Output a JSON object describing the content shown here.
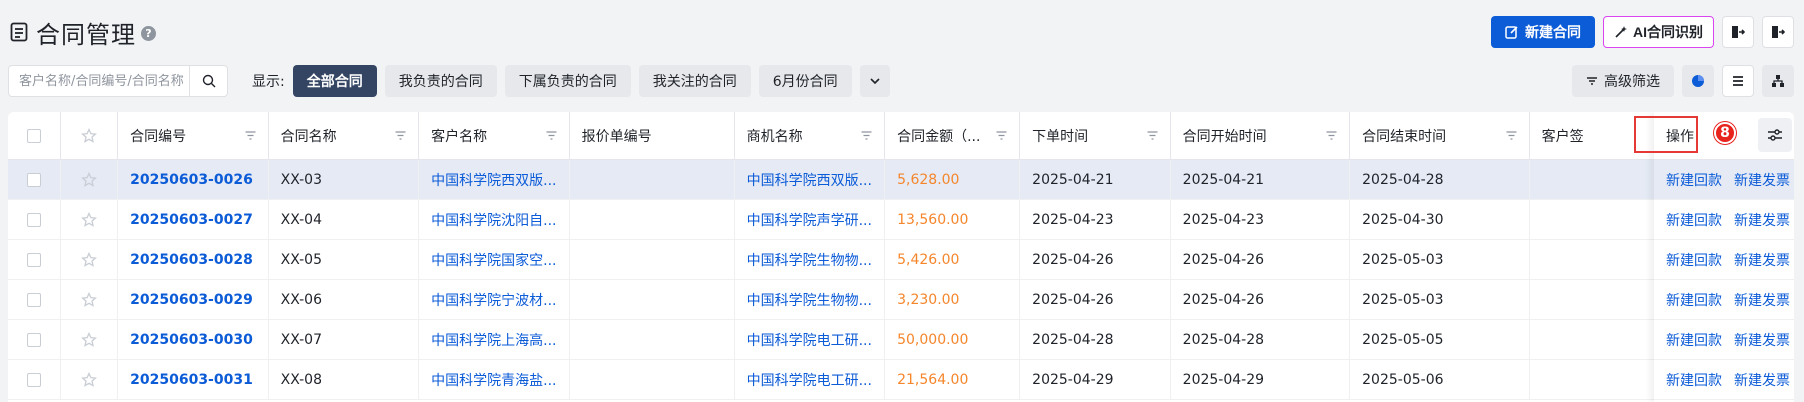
{
  "header": {
    "title": "合同管理",
    "help": "?",
    "new_contract": "新建合同",
    "ai_recognize": "AI合同识别"
  },
  "filters": {
    "search_placeholder": "客户名称/合同编号/合同名称",
    "show_label": "显示:",
    "chips": [
      "全部合同",
      "我负责的合同",
      "下属负责的合同",
      "我关注的合同",
      "6月份合同"
    ],
    "active_chip": "全部合同",
    "advanced_filter": "高级筛选"
  },
  "table": {
    "columns": [
      "合同编号",
      "合同名称",
      "客户名称",
      "报价单编号",
      "商机名称",
      "合同金额（...",
      "下单时间",
      "合同开始时间",
      "合同结束时间",
      "客户签"
    ],
    "ops_header": "操作",
    "rows": [
      {
        "no": "20250603-0026",
        "name": "XX-03",
        "customer": "中国科学院西双版...",
        "quote": "",
        "opportunity": "中国科学院西双版...",
        "amount": "5,628.00",
        "order_date": "2025-04-21",
        "start": "2025-04-21",
        "end": "2025-04-28"
      },
      {
        "no": "20250603-0027",
        "name": "XX-04",
        "customer": "中国科学院沈阳自...",
        "quote": "",
        "opportunity": "中国科学院声学研...",
        "amount": "13,560.00",
        "order_date": "2025-04-23",
        "start": "2025-04-23",
        "end": "2025-04-30"
      },
      {
        "no": "20250603-0028",
        "name": "XX-05",
        "customer": "中国科学院国家空...",
        "quote": "",
        "opportunity": "中国科学院生物物...",
        "amount": "5,426.00",
        "order_date": "2025-04-26",
        "start": "2025-04-26",
        "end": "2025-05-03"
      },
      {
        "no": "20250603-0029",
        "name": "XX-06",
        "customer": "中国科学院宁波材...",
        "quote": "",
        "opportunity": "中国科学院生物物...",
        "amount": "3,230.00",
        "order_date": "2025-04-26",
        "start": "2025-04-26",
        "end": "2025-05-03"
      },
      {
        "no": "20250603-0030",
        "name": "XX-07",
        "customer": "中国科学院上海高...",
        "quote": "",
        "opportunity": "中国科学院电工研...",
        "amount": "50,000.00",
        "order_date": "2025-04-28",
        "start": "2025-04-28",
        "end": "2025-05-05"
      },
      {
        "no": "20250603-0031",
        "name": "XX-08",
        "customer": "中国科学院青海盐...",
        "quote": "",
        "opportunity": "中国科学院电工研...",
        "amount": "21,564.00",
        "order_date": "2025-04-29",
        "start": "2025-04-29",
        "end": "2025-05-06"
      }
    ],
    "op_payment": "新建回款",
    "op_invoice": "新建发票"
  },
  "annotation": {
    "badge": "8",
    "color": "#e53935"
  },
  "colors": {
    "primary": "#0c5bd7",
    "amount": "#f5862b",
    "active_chip": "#344563",
    "ai_border": "#d946ef"
  }
}
